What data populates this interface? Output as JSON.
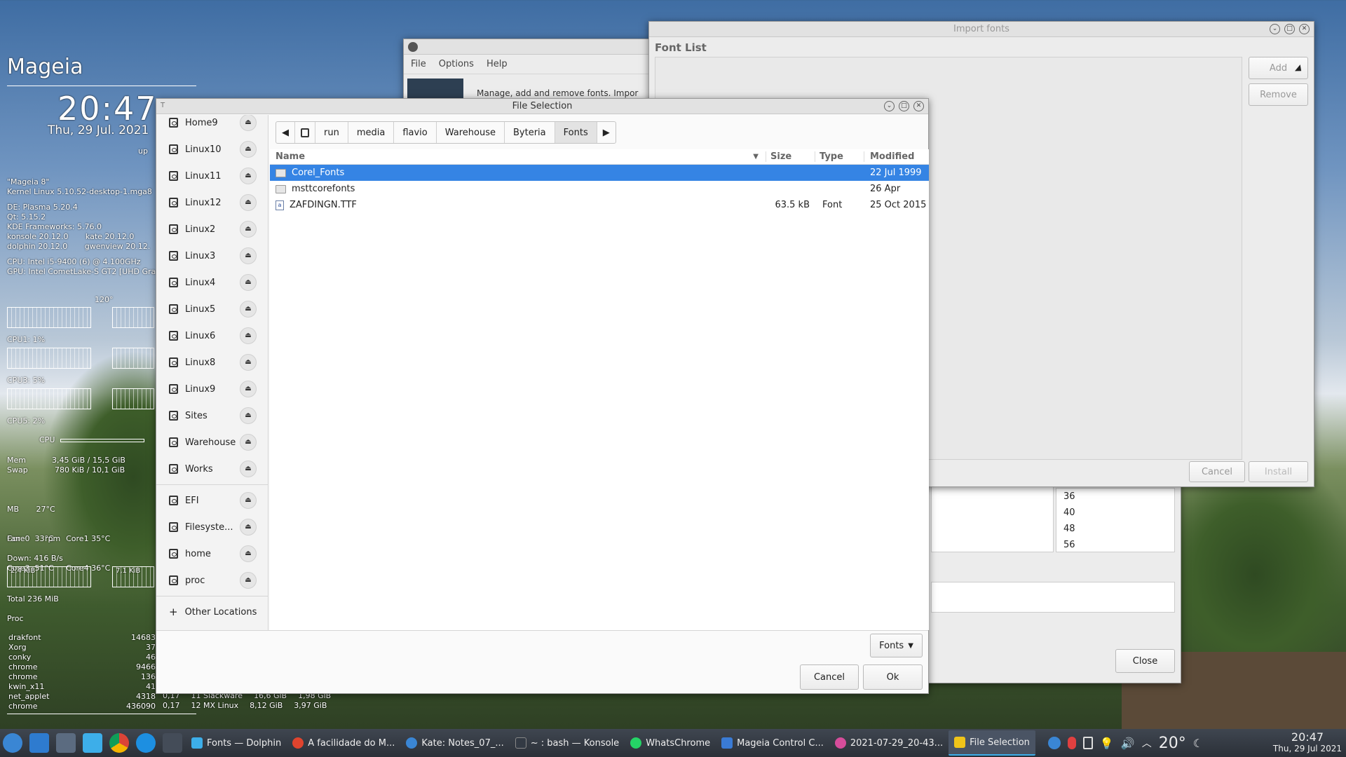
{
  "desktop": {
    "conky": {
      "distro": "Mageia",
      "time": "20:47",
      "date": "Thu, 29 Jul. 2021",
      "uptime_label": "up",
      "lines": [
        "\"Mageia 8\"",
        "Kernel Linux 5.10.52-desktop-1.mga8",
        "DE: Plasma 5.20.4",
        "Qt: 5.15.2",
        "KDE Frameworks: 5.76.0",
        "konsole 20.12.0       kate 20.12.0",
        "dolphin 20.12.0       gwenview 20.12.",
        "CPU: Intel i5-9400 (6) @ 4.100GHz",
        "GPU: Intel CometLake-S GT2 [UHD Gra"
      ],
      "temp_label": "120°",
      "cpu_labels": [
        "CPU1: 1%",
        "CPU3: 5%",
        "CPU5: 2%"
      ],
      "cpu_bar_label": "CPU",
      "mem": [
        "Mem",
        "3,45 GiB / 15,5 GiB"
      ],
      "swap": [
        "Swap",
        "780 KiB / 10,1 GiB"
      ],
      "sensors": [
        "MB       27°C",
        "Core0  33°C     Core1 35°C",
        "Core3  51°C     Core4 36°C"
      ],
      "fan": "Fan          rpm",
      "down": "Down: 416 B/s",
      "down_graph": "2,4 KiB",
      "up_graph": "7,1 KiB",
      "total": "Total 236 MiB",
      "proc_header": "Proc",
      "procs": [
        {
          "name": "drakfont",
          "pid": "14683"
        },
        {
          "name": "Xorg",
          "pid": "37"
        },
        {
          "name": "conky",
          "pid": "46"
        },
        {
          "name": "chrome",
          "pid": "9466"
        },
        {
          "name": "chrome",
          "pid": "136"
        },
        {
          "name": "kwin_x11",
          "pid": "41"
        },
        {
          "name": "net_applet",
          "pid": "4318"
        },
        {
          "name": "chrome",
          "pid": "436090"
        }
      ],
      "disk_rows": [
        [
          "0,17",
          "11 Slackware",
          "16,6 GiB",
          "1,98 GiB"
        ],
        [
          "0,17",
          "12 MX Linux",
          "8,12 GiB",
          "3,97 GiB"
        ]
      ]
    }
  },
  "font_manager": {
    "menu": [
      "File",
      "Options",
      "Help"
    ],
    "banner": "Manage, add and remove fonts. Impor",
    "sizes": [
      "36",
      "40",
      "48",
      "56"
    ],
    "close": "Close"
  },
  "import_fonts": {
    "title": "Import fonts",
    "font_list_label": "Font List",
    "add": "Add",
    "remove": "Remove",
    "cancel": "Cancel",
    "install": "Install"
  },
  "file_selection": {
    "title": "File Selection",
    "places": [
      "Home9",
      "Linux10",
      "Linux11",
      "Linux12",
      "Linux2",
      "Linux3",
      "Linux4",
      "Linux5",
      "Linux6",
      "Linux8",
      "Linux9",
      "Sites",
      "Warehouse",
      "Works"
    ],
    "devices": [
      "EFI",
      "Filesyste...",
      "home",
      "proc"
    ],
    "other_locations": "Other Locations",
    "crumbs": [
      "run",
      "media",
      "flavio",
      "Warehouse",
      "Byteria",
      "Fonts"
    ],
    "columns": {
      "name": "Name",
      "size": "Size",
      "type": "Type",
      "modified": "Modified"
    },
    "files": [
      {
        "name": "Corel_Fonts",
        "size": "",
        "type": "",
        "modified": "22 Jul 1999",
        "kind": "folder"
      },
      {
        "name": "msttcorefonts",
        "size": "",
        "type": "",
        "modified": "26 Apr",
        "kind": "folder"
      },
      {
        "name": "ZAFDINGN.TTF",
        "size": "63.5 kB",
        "type": "Font",
        "modified": "25 Oct 2015",
        "kind": "font"
      }
    ],
    "filter": "Fonts",
    "cancel": "Cancel",
    "ok": "Ok"
  },
  "taskbar": {
    "tasks": [
      {
        "label": "Fonts — Dolphin",
        "color": "#3daee9"
      },
      {
        "label": "A facilidade do M...",
        "color": "#e0442e"
      },
      {
        "label": "Kate: Notes_07_...",
        "color": "#3a86d4"
      },
      {
        "label": "~ : bash — Konsole",
        "color": "#333a44"
      },
      {
        "label": "WhatsChrome",
        "color": "#25d366"
      },
      {
        "label": "Mageia Control C...",
        "color": "#3a7bd5"
      },
      {
        "label": "2021-07-29_20-43...",
        "color": "#d64d9b"
      },
      {
        "label": "File Selection",
        "color": "#f0c419"
      }
    ],
    "weather": "20°",
    "clock_time": "20:47",
    "clock_date": "Thu, 29 Jul 2021"
  }
}
